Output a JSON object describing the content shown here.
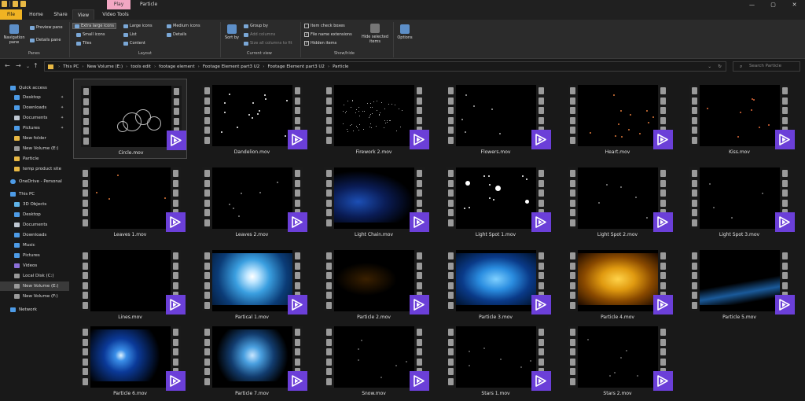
{
  "window": {
    "title": "Particle",
    "context_tab": "Play",
    "controls": {
      "minimize": "—",
      "maximize": "▢",
      "close": "✕"
    }
  },
  "ribbon_tabs": [
    {
      "label": "File"
    },
    {
      "label": "Home"
    },
    {
      "label": "Share"
    },
    {
      "label": "View"
    },
    {
      "label": "Video Tools"
    }
  ],
  "ribbon": {
    "panes": {
      "navigation_pane": "Navigation pane",
      "preview_pane": "Preview pane",
      "details_pane": "Details pane",
      "group_label": "Panes"
    },
    "layout": {
      "extra_large_icons": "Extra large icons",
      "large_icons": "Large icons",
      "medium_icons": "Medium icons",
      "small_icons": "Small icons",
      "list": "List",
      "details": "Details",
      "tiles": "Tiles",
      "content": "Content",
      "group_label": "Layout"
    },
    "current_view": {
      "sort_by": "Sort by",
      "group_by": "Group by",
      "add_columns": "Add columns",
      "size_all_columns": "Size all columns to fit",
      "group_label": "Current view"
    },
    "show_hide": {
      "item_check_boxes": "Item check boxes",
      "file_name_extensions": "File name extensions",
      "hidden_items": "Hidden items",
      "hide_selected": "Hide selected items",
      "group_label": "Show/hide"
    },
    "options": "Options"
  },
  "address_bar": {
    "crumbs": [
      "This PC",
      "New Volume (E:)",
      "tools edit",
      "footage element",
      "Footage Element part3 U2",
      "Footage Element part3 U2",
      "Particle"
    ],
    "search_placeholder": "Search Particle"
  },
  "sidebar": {
    "items": [
      {
        "label": "Quick access"
      },
      {
        "label": "Desktop"
      },
      {
        "label": "Downloads"
      },
      {
        "label": "Documents"
      },
      {
        "label": "Pictures"
      },
      {
        "label": "New folder"
      },
      {
        "label": "New Volume (E:)"
      },
      {
        "label": "Particle"
      },
      {
        "label": "temp product site"
      },
      {
        "label": "OneDrive - Personal"
      },
      {
        "label": "This PC"
      },
      {
        "label": "3D Objects"
      },
      {
        "label": "Desktop"
      },
      {
        "label": "Documents"
      },
      {
        "label": "Downloads"
      },
      {
        "label": "Music"
      },
      {
        "label": "Pictures"
      },
      {
        "label": "Videos"
      },
      {
        "label": "Local Disk (C:)"
      },
      {
        "label": "New Volume (E:)"
      },
      {
        "label": "New Volume (F:)"
      },
      {
        "label": "Network"
      }
    ]
  },
  "files": [
    {
      "name": "Circle.mov"
    },
    {
      "name": "Dandelion.mov"
    },
    {
      "name": "Firework 2.mov"
    },
    {
      "name": "Flowers.mov"
    },
    {
      "name": "Heart.mov"
    },
    {
      "name": "Kiss.mov"
    },
    {
      "name": "Leaves 1.mov"
    },
    {
      "name": "Leaves 2.mov"
    },
    {
      "name": "Light Chain.mov"
    },
    {
      "name": "Light Spot 1.mov"
    },
    {
      "name": "Light Spot 2.mov"
    },
    {
      "name": "Light Spot 3.mov"
    },
    {
      "name": "Lines.mov"
    },
    {
      "name": "Partical 1.mov"
    },
    {
      "name": "Particle 2.mov"
    },
    {
      "name": "Particle 3.mov"
    },
    {
      "name": "Particle 4.mov"
    },
    {
      "name": "Particle 5.mov"
    },
    {
      "name": "Particle 6.mov"
    },
    {
      "name": "Particle 7.mov"
    },
    {
      "name": "Snow.mov"
    },
    {
      "name": "Stars 1.mov"
    },
    {
      "name": "Stars 2.mov"
    }
  ],
  "colors": {
    "accent": "#6b3fd8",
    "file_tab": "#f0b323",
    "context_tab": "#f2a7c3"
  }
}
